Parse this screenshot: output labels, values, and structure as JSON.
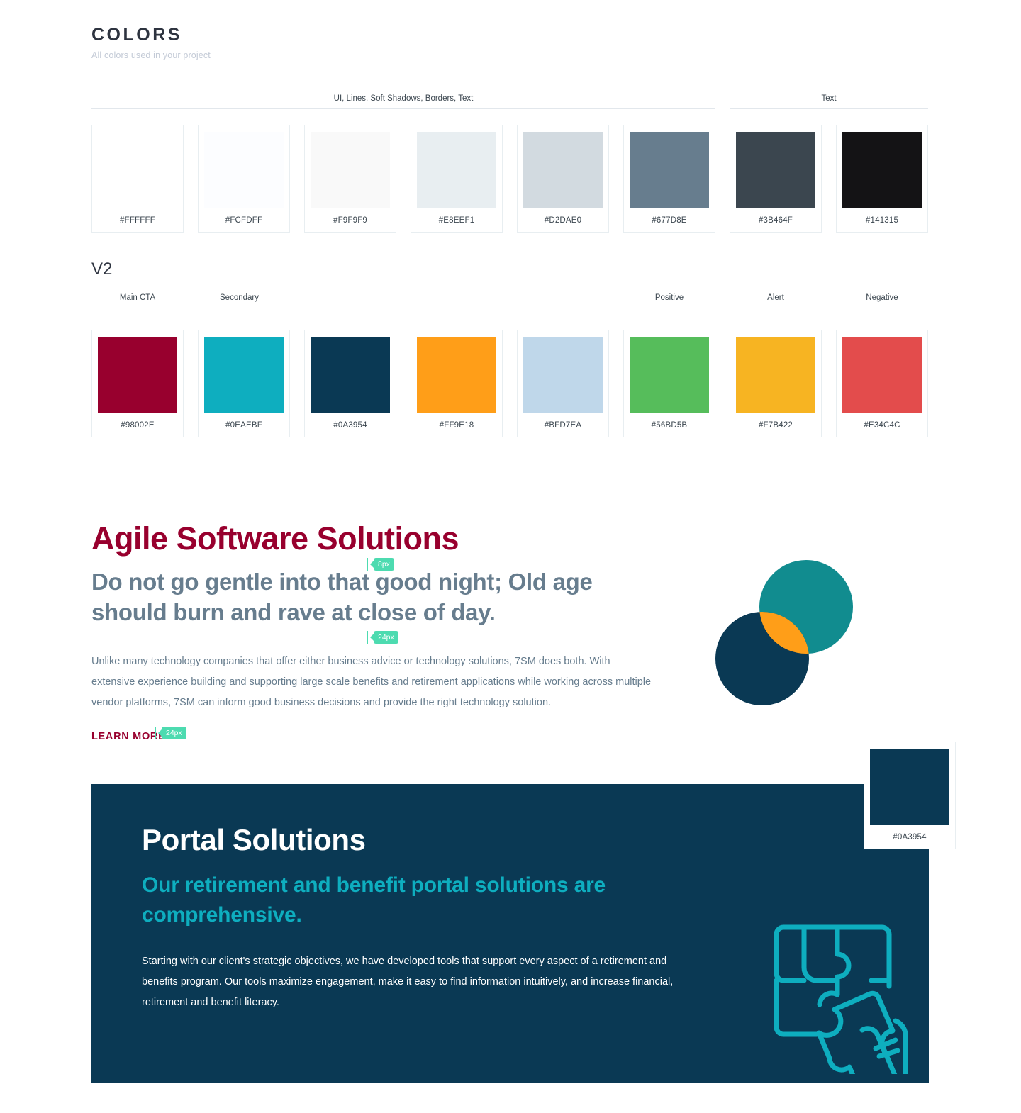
{
  "header": {
    "title": "COLORS",
    "subtitle": "All colors used in your project"
  },
  "palette_v1": {
    "groups": [
      {
        "label": "UI, Lines, Soft Shadows, Borders, Text",
        "span": 6
      },
      {
        "label": "Text",
        "span": 2
      }
    ],
    "swatches": [
      {
        "hex": "#FFFFFF",
        "label": "#FFFFFF"
      },
      {
        "hex": "#FCFDFF",
        "label": "#FCFDFF"
      },
      {
        "hex": "#F9F9F9",
        "label": "#F9F9F9"
      },
      {
        "hex": "#E8EEF1",
        "label": "#E8EEF1"
      },
      {
        "hex": "#D2DAE0",
        "label": "#D2DAE0"
      },
      {
        "hex": "#677D8E",
        "label": "#677D8E"
      },
      {
        "hex": "#3B464F",
        "label": "#3B464F"
      },
      {
        "hex": "#141315",
        "label": "#141315"
      }
    ]
  },
  "palette_v2": {
    "heading": "V2",
    "groups": [
      {
        "label": "Main CTA",
        "span": 1
      },
      {
        "label": "Secondary",
        "span": 4
      },
      {
        "label": "Positive",
        "span": 1
      },
      {
        "label": "Alert",
        "span": 1
      },
      {
        "label": "Negative",
        "span": 1
      }
    ],
    "swatches": [
      {
        "hex": "#98002E",
        "label": "#98002E"
      },
      {
        "hex": "#0EAEBF",
        "label": "#0EAEBF"
      },
      {
        "hex": "#0A3954",
        "label": "#0A3954"
      },
      {
        "hex": "#FF9E18",
        "label": "#FF9E18"
      },
      {
        "hex": "#BFD7EA",
        "label": "#BFD7EA"
      },
      {
        "hex": "#56BD5B",
        "label": "#56BD5B"
      },
      {
        "hex": "#F7B422",
        "label": "#F7B422"
      },
      {
        "hex": "#E34C4C",
        "label": "#E34C4C"
      }
    ]
  },
  "marketing": {
    "title": "Agile Software Solutions",
    "subtitle": "Do not go gentle into that good night; Old age should burn and rave at close of day.",
    "body": "Unlike many technology companies that offer either business advice or technology solutions, 7SM does both.  With extensive experience building and supporting large scale benefits and retirement applications while working across multiple vendor platforms, 7SM can inform good business decisions and provide the right technology solution.",
    "link_label": "LEARN MORE",
    "spacers": [
      {
        "value": "8px"
      },
      {
        "value": "24px"
      },
      {
        "value": "24px"
      }
    ],
    "graphic": {
      "name": "overlapping-circles",
      "circle_a_color": "#118C8F",
      "circle_b_color": "#0A3954",
      "overlap_color": "#FF9E18"
    }
  },
  "portal": {
    "title": "Portal Solutions",
    "subtitle": "Our retirement and benefit portal solutions are comprehensive.",
    "body": "Starting with our client's strategic objectives, we have developed tools that support every aspect of a retirement and benefits program. Our tools maximize engagement, make it easy to find information intuitively, and increase financial, retirement and benefit literacy.",
    "background_color": "#0A3954",
    "accent_color": "#0EAEBF",
    "illustration": "puzzle-hand-icon"
  },
  "floating_swatch": {
    "hex": "#0A3954",
    "label": "#0A3954"
  }
}
